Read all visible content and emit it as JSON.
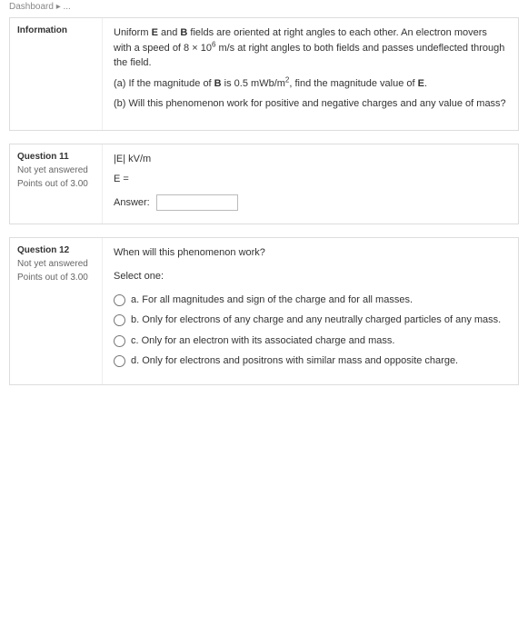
{
  "breadcrumb": "Dashboard ▸ ...",
  "info": {
    "label": "Information",
    "para1_pre": "Uniform ",
    "para1_b1": "E",
    "para1_mid1": " and ",
    "para1_b2": "B",
    "para1_mid2": " fields are oriented at right angles to each other. An electron movers with a speed of 8 × 10",
    "para1_exp": "6",
    "para1_post": " m/s at right angles to both fields and passes undeflected through the field.",
    "para2_pre": "(a) If the magnitude of ",
    "para2_b": "B",
    "para2_mid": " is 0.5 mWb/m",
    "para2_exp": "2",
    "para2_post": ", find the magnitude value of ",
    "para2_b2": "E",
    "para2_end": ".",
    "para3": "(b) Will this phenomenon work for positive and negative charges and any value of mass?"
  },
  "q11": {
    "title": "Question 11",
    "status": "Not yet answered",
    "points": "Points out of 3.00",
    "line1": "|E| kV/m",
    "line2": "E =",
    "answer_label": "Answer:",
    "answer_value": ""
  },
  "q12": {
    "title": "Question 12",
    "status": "Not yet answered",
    "points": "Points out of 3.00",
    "prompt": "When will this phenomenon work?",
    "select_one": "Select one:",
    "options": {
      "a": "a. For all magnitudes and sign of the charge and for all masses.",
      "b": "b. Only for electrons of any charge and any neutrally charged particles of any mass.",
      "c": "c. Only for an electron with its associated charge and mass.",
      "d": "d. Only for electrons and positrons with similar mass and opposite charge."
    }
  }
}
